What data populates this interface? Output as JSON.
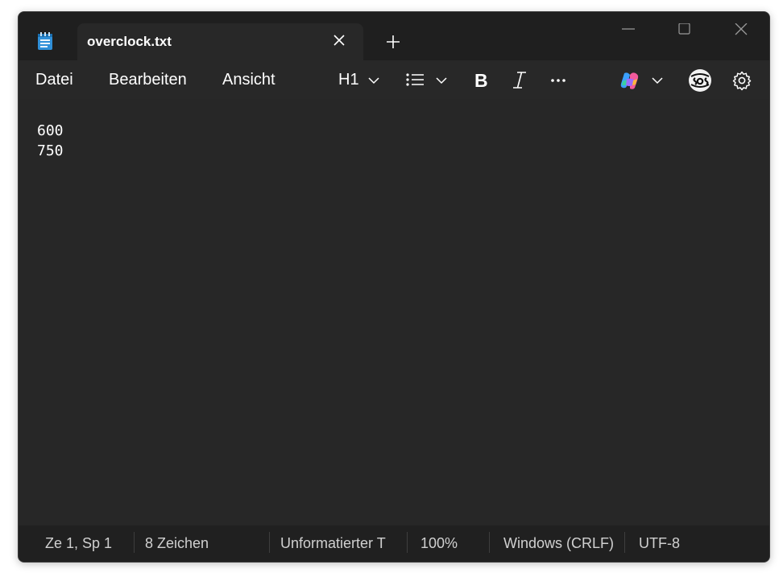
{
  "tab": {
    "title": "overclock.txt"
  },
  "menu": {
    "file": "Datei",
    "edit": "Bearbeiten",
    "view": "Ansicht"
  },
  "toolbar": {
    "heading_label": "H1"
  },
  "editor": {
    "content": "600\n750"
  },
  "status": {
    "position": "Ze 1, Sp 1",
    "chars": "8 Zeichen",
    "format": "Unformatierter T",
    "zoom": "100%",
    "line_ending": "Windows (CRLF)",
    "encoding": "UTF-8"
  },
  "colors": {
    "window_bg": "#272727",
    "titlebar_bg": "#1f1f1f",
    "accent": "#4aa3ff"
  },
  "icons": [
    "notepad-icon",
    "close-icon",
    "plus-icon",
    "minimize-icon",
    "maximize-icon",
    "chevron-down-icon",
    "list-icon",
    "bold-icon",
    "italic-icon",
    "more-icon",
    "copilot-icon",
    "avatar",
    "gear-icon"
  ]
}
